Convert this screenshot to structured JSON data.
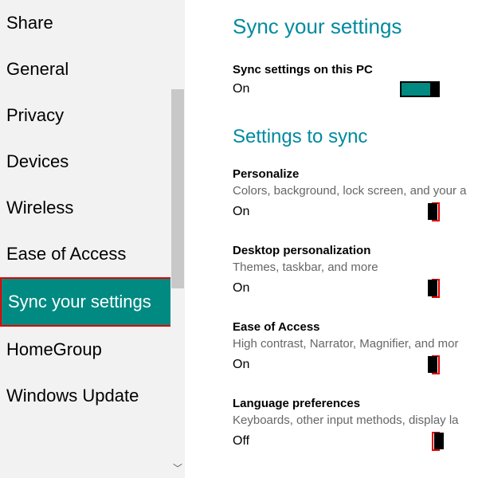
{
  "sidebar": {
    "items": [
      {
        "label": "Share"
      },
      {
        "label": "General"
      },
      {
        "label": "Privacy"
      },
      {
        "label": "Devices"
      },
      {
        "label": "Wireless"
      },
      {
        "label": "Ease of Access"
      },
      {
        "label": "Sync your settings"
      },
      {
        "label": "HomeGroup"
      },
      {
        "label": "Windows Update"
      }
    ],
    "selected_index": 6
  },
  "main": {
    "title": "Sync your settings",
    "master": {
      "label": "Sync settings on this PC",
      "state": "On",
      "on": true
    },
    "section_title": "Settings to sync",
    "groups": [
      {
        "label": "Personalize",
        "desc": "Colors, background, lock screen, and your a",
        "state": "On",
        "on": true,
        "highlight": true
      },
      {
        "label": "Desktop personalization",
        "desc": "Themes, taskbar, and more",
        "state": "On",
        "on": true,
        "highlight": true
      },
      {
        "label": "Ease of Access",
        "desc": "High contrast, Narrator, Magnifier, and mor",
        "state": "On",
        "on": true,
        "highlight": true
      },
      {
        "label": "Language preferences",
        "desc": "Keyboards, other input methods, display la",
        "state": "Off",
        "on": false,
        "highlight": true
      }
    ]
  }
}
